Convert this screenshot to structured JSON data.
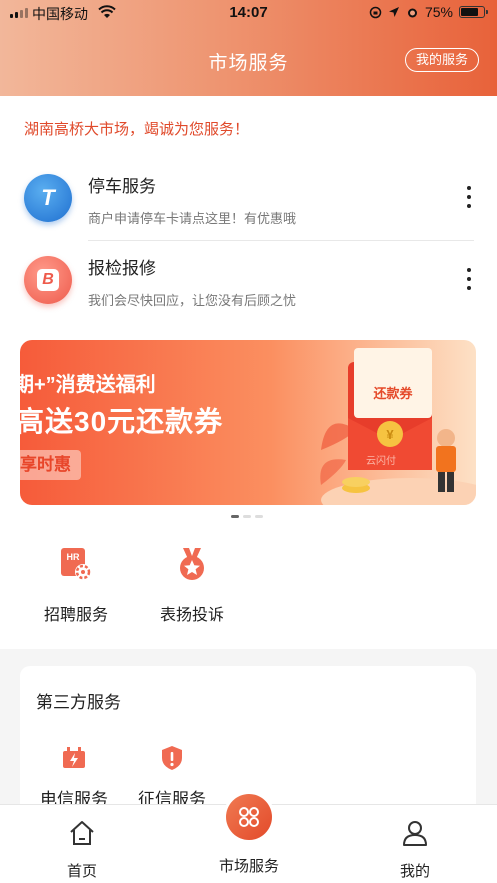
{
  "status_bar": {
    "carrier": "中国移动",
    "time": "14:07",
    "battery": "75%",
    "battery_level": 0.75
  },
  "header": {
    "title": "市场服务",
    "my_services_label": "我的服务"
  },
  "greeting": "湖南高桥大市场，竭诚为您服务！",
  "services": [
    {
      "name": "停车服务",
      "desc": "商户申请停车卡请点这里！有优惠哦",
      "icon": "parking-t-icon",
      "icon_letter": "T",
      "color": "#2a80e0"
    },
    {
      "name": "报检报修",
      "desc": "我们会尽快回应，让您没有后顾之忧",
      "icon": "repair-b-icon",
      "icon_letter": "B",
      "color": "#ee6a5a"
    }
  ],
  "banner": {
    "line1": "期+”消费送福利",
    "line2": "高送30元还款券",
    "button": "享时惠",
    "coupon_label": "还款券",
    "brand": "云闪付"
  },
  "quick_services": [
    {
      "label": "招聘服务",
      "icon": "hr-recruit-icon",
      "icon_text": "HR"
    },
    {
      "label": "表扬投诉",
      "icon": "medal-star-icon"
    }
  ],
  "third_party": {
    "title": "第三方服务",
    "items": [
      {
        "label": "电信服务",
        "icon": "telecom-charge-icon"
      },
      {
        "label": "征信服务",
        "icon": "credit-shield-icon"
      }
    ]
  },
  "bottom_nav": {
    "items": [
      {
        "label": "首页",
        "icon": "home-icon"
      },
      {
        "label": "市场服务",
        "icon": "market-grid-icon"
      },
      {
        "label": "我的",
        "icon": "user-icon"
      }
    ]
  },
  "colors": {
    "accent": "#e8623a",
    "greeting": "#e04a2b"
  }
}
